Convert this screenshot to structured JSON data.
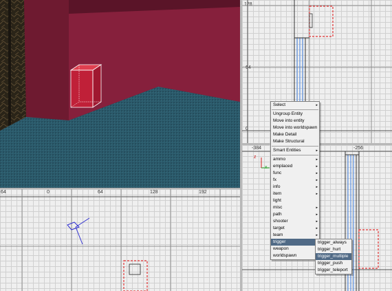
{
  "viewports": {
    "top_right": {
      "labels": [
        "128",
        "64",
        "0"
      ]
    },
    "bottom_right": {
      "labels": [
        "-384",
        "-256",
        "z",
        "x"
      ]
    },
    "bottom_left": {
      "labels": [
        "64",
        "0",
        "64",
        "128",
        "192"
      ]
    }
  },
  "context_menu": {
    "items": [
      {
        "label": "Select",
        "submenu": true
      },
      {
        "label": "Ungroup Entity"
      },
      {
        "label": "Move into entity"
      },
      {
        "label": "Move into worldspawn"
      },
      {
        "label": "Make Detail"
      },
      {
        "label": "Make Structural"
      },
      {
        "label": "Smart Entities",
        "submenu": true
      },
      {
        "label": "ammo",
        "submenu": true
      },
      {
        "label": "emplaced",
        "submenu": true
      },
      {
        "label": "func",
        "submenu": true
      },
      {
        "label": "fx",
        "submenu": true
      },
      {
        "label": "info",
        "submenu": true
      },
      {
        "label": "item",
        "submenu": true
      },
      {
        "label": "light"
      },
      {
        "label": "misc",
        "submenu": true
      },
      {
        "label": "path",
        "submenu": true
      },
      {
        "label": "shooter",
        "submenu": true
      },
      {
        "label": "target",
        "submenu": true
      },
      {
        "label": "team",
        "submenu": true
      },
      {
        "label": "trigger",
        "submenu": true
      },
      {
        "label": "weapon",
        "submenu": true
      },
      {
        "label": "worldspawn"
      }
    ],
    "submenu_arrow": "▸"
  },
  "trigger_submenu": {
    "items": [
      "trigger_always",
      "trigger_hurt",
      "trigger_multiple",
      "trigger_push",
      "trigger_teleport"
    ],
    "highlighted": "trigger_multiple"
  },
  "colors": {
    "wall": "#8a1f3a",
    "floor": "#2a5a6a",
    "selection": "#e03030",
    "highlight": "#506a86"
  }
}
